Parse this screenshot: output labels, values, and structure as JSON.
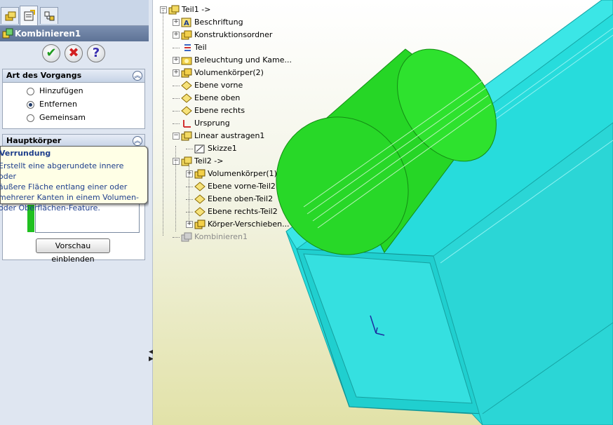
{
  "property_manager": {
    "title": "Kombinieren1",
    "buttons": {
      "ok": "✔",
      "cancel": "✖",
      "help": "?"
    },
    "operation_group": {
      "title": "Art des Vorgangs",
      "options": [
        {
          "label": "Hinzufügen",
          "selected": false
        },
        {
          "label": "Entfernen",
          "selected": true
        },
        {
          "label": "Gemeinsam",
          "selected": false
        }
      ]
    },
    "main_body_group": {
      "title": "Hauptkörper"
    },
    "tooltip": {
      "title": "Verrundung",
      "lines": [
        "Erstellt eine abgerundete innere oder",
        "äußere Fläche entlang einer oder",
        "mehrerer Kanten in einem Volumen-",
        "oder Oberflächen-Feature."
      ]
    },
    "preview_button": "Vorschau einblenden"
  },
  "feature_tree": {
    "items": [
      {
        "label": "Teil1 ->",
        "level": 0,
        "expander": "−",
        "icon": "part-icon"
      },
      {
        "label": "Beschriftung",
        "level": 1,
        "expander": "+",
        "icon": "annotation-icon"
      },
      {
        "label": "Konstruktionsordner",
        "level": 1,
        "expander": "+",
        "icon": "design-folder-icon"
      },
      {
        "label": "Teil",
        "level": 1,
        "expander": "",
        "icon": "material-icon"
      },
      {
        "label": "Beleuchtung und Kame...",
        "level": 1,
        "expander": "+",
        "icon": "lighting-icon"
      },
      {
        "label": "Volumenkörper(2)",
        "level": 1,
        "expander": "+",
        "icon": "solid-bodies-icon"
      },
      {
        "label": "Ebene vorne",
        "level": 1,
        "expander": "",
        "icon": "plane-icon"
      },
      {
        "label": "Ebene oben",
        "level": 1,
        "expander": "",
        "icon": "plane-icon"
      },
      {
        "label": "Ebene rechts",
        "level": 1,
        "expander": "",
        "icon": "plane-icon"
      },
      {
        "label": "Ursprung",
        "level": 1,
        "expander": "",
        "icon": "origin-icon"
      },
      {
        "label": "Linear austragen1",
        "level": 1,
        "expander": "−",
        "icon": "extrude-icon"
      },
      {
        "label": "Skizze1",
        "level": 2,
        "expander": "",
        "icon": "sketch-icon"
      },
      {
        "label": "Teil2 ->",
        "level": 1,
        "expander": "−",
        "icon": "part-icon"
      },
      {
        "label": "Volumenkörper(1)",
        "level": 2,
        "expander": "+",
        "icon": "solid-bodies-icon"
      },
      {
        "label": "Ebene vorne-Teil2",
        "level": 2,
        "expander": "",
        "icon": "plane-icon"
      },
      {
        "label": "Ebene oben-Teil2",
        "level": 2,
        "expander": "",
        "icon": "plane-icon"
      },
      {
        "label": "Ebene rechts-Teil2",
        "level": 2,
        "expander": "",
        "icon": "plane-icon"
      },
      {
        "label": "Körper-Verschieben...",
        "level": 2,
        "expander": "+",
        "icon": "move-body-icon"
      },
      {
        "label": "Kombinieren1",
        "level": 1,
        "expander": "",
        "icon": "combine-icon",
        "greyed": true
      }
    ]
  },
  "colors": {
    "cylinder": "#2ad62a",
    "tube": "#27dcdc",
    "tooltip_text": "#1e3e8c",
    "tree_text_greyed": "#8a8a8a"
  }
}
